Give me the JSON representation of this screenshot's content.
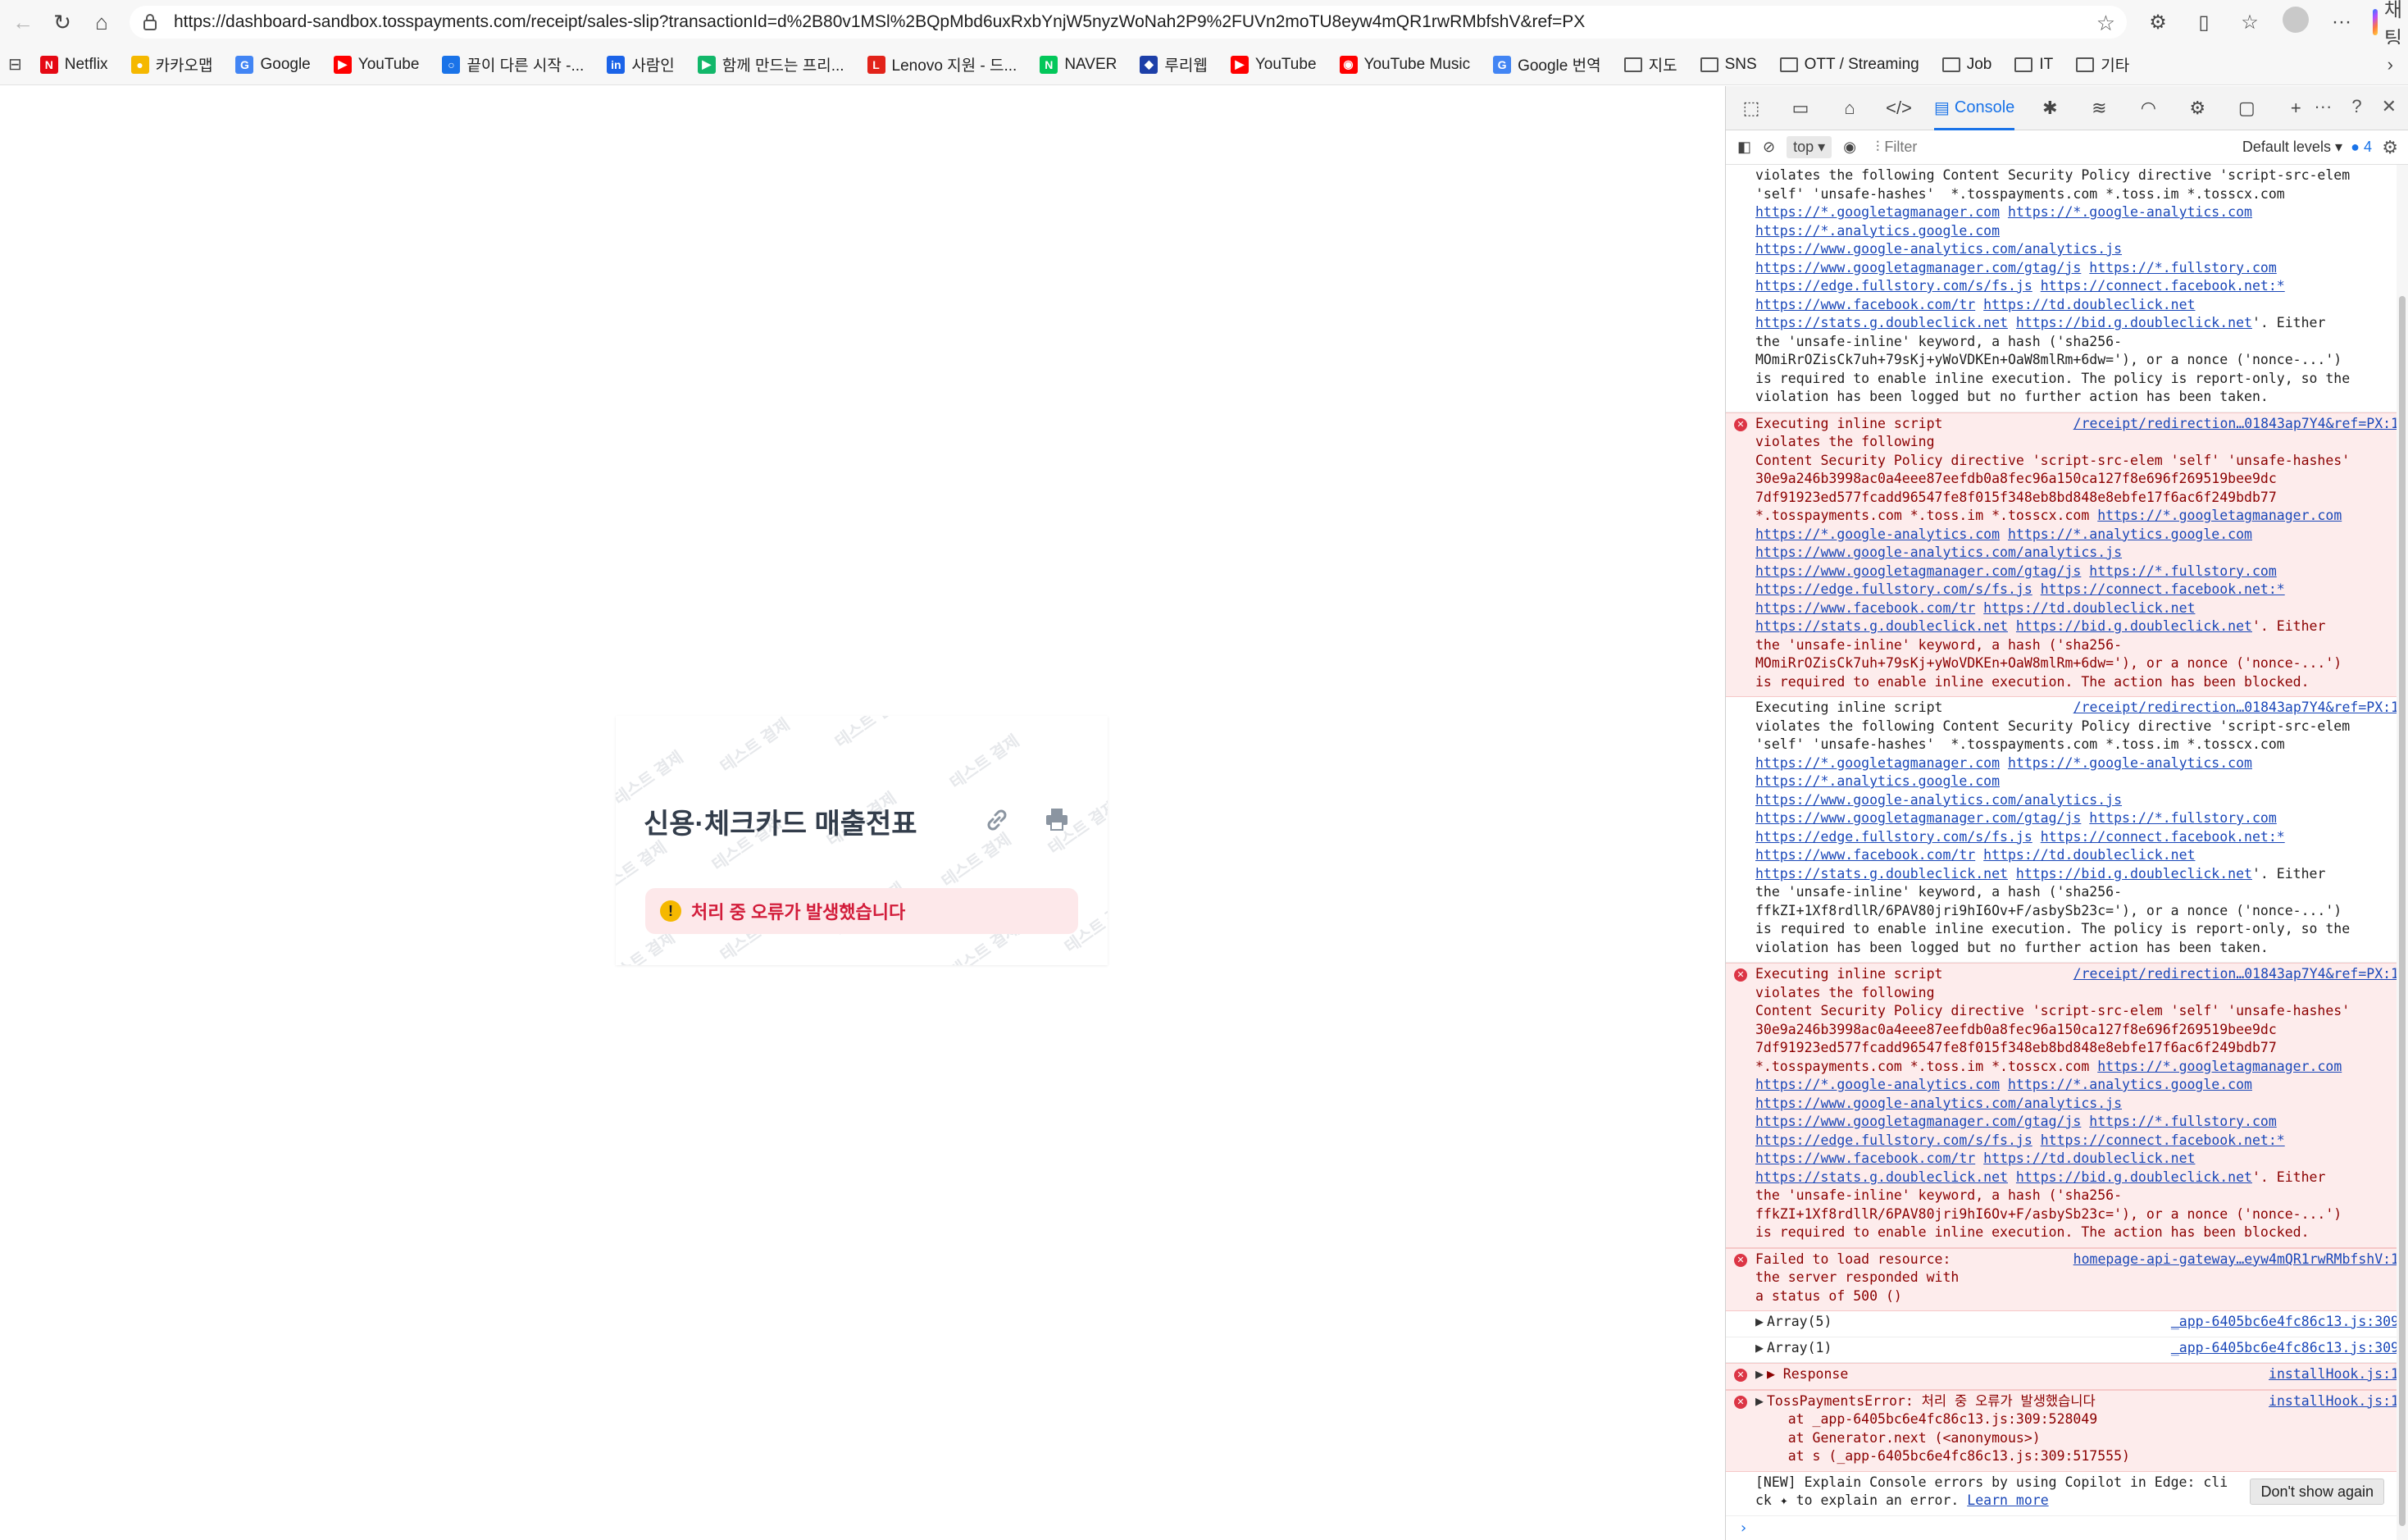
{
  "browser": {
    "url": "https://dashboard-sandbox.tosspayments.com/receipt/sales-slip?transactionId=d%2B80v1MSl%2BQpMbd6uxRxbYnjW5nyzWoNah2P9%2FUVn2moTU8eyw4mQR1rwRMbfshV&ref=PX",
    "copilot_label": "채팅"
  },
  "bookmarks": [
    {
      "label": "Netflix",
      "icon": "netflix-icon",
      "color": "#e50914",
      "glyph": "N"
    },
    {
      "label": "카카오맵",
      "icon": "kakaomap-icon",
      "color": "#f5b800",
      "glyph": "●"
    },
    {
      "label": "Google",
      "icon": "google-icon",
      "color": "#4285f4",
      "glyph": "G"
    },
    {
      "label": "YouTube",
      "icon": "youtube-icon",
      "color": "#ff0000",
      "glyph": "▶"
    },
    {
      "label": "끝이 다른 시작 -...",
      "icon": "chat-bubble-icon",
      "color": "#1a73e8",
      "glyph": "○"
    },
    {
      "label": "사람인",
      "icon": "saramin-icon",
      "color": "#1b63e8",
      "glyph": "in"
    },
    {
      "label": "함께 만드는 프리...",
      "icon": "green-logo-icon",
      "color": "#12b76a",
      "glyph": "▶"
    },
    {
      "label": "Lenovo 지원 - 드...",
      "icon": "lenovo-icon",
      "color": "#e2231a",
      "glyph": "L"
    },
    {
      "label": "NAVER",
      "icon": "naver-icon",
      "color": "#03c75a",
      "glyph": "N"
    },
    {
      "label": "루리웹",
      "icon": "ruliweb-icon",
      "color": "#1d3fa8",
      "glyph": "◆"
    },
    {
      "label": "YouTube",
      "icon": "youtube-icon",
      "color": "#ff0000",
      "glyph": "▶"
    },
    {
      "label": "YouTube Music",
      "icon": "youtube-music-icon",
      "color": "#ff0000",
      "glyph": "◉"
    },
    {
      "label": "Google 번역",
      "icon": "google-translate-icon",
      "color": "#4285f4",
      "glyph": "G"
    },
    {
      "label": "지도",
      "icon": "folder-icon",
      "folder": true
    },
    {
      "label": "SNS",
      "icon": "folder-icon",
      "folder": true
    },
    {
      "label": "OTT / Streaming",
      "icon": "folder-icon",
      "folder": true
    },
    {
      "label": "Job",
      "icon": "folder-icon",
      "folder": true
    },
    {
      "label": "IT",
      "icon": "folder-icon",
      "folder": true
    },
    {
      "label": "기타",
      "icon": "folder-icon",
      "folder": true
    }
  ],
  "receipt": {
    "title": "신용·체크카드 매출전표",
    "error": "처리 중 오류가 발생했습니다",
    "watermark": "테스트 결제"
  },
  "devtools": {
    "console_tab": "Console",
    "context": "top",
    "filter_placeholder": "Filter",
    "levels": "Default levels",
    "issues_count": "4",
    "dont_show": "Don't show again",
    "copilot_hint_prefix": "[NEW] Explain Console errors by using Copilot in Edge: click ",
    "copilot_hint_suffix": " to explain an error. ",
    "learn_more": "Learn more"
  },
  "console_messages": [
    {
      "level": "warning",
      "lines": [
        "violates the following Content Security Policy directive 'script-src-elem",
        "'self' 'unsafe-hashes'  *.tosspayments.com *.toss.im *.tosscx.com",
        "https://*.googletagmanager.com https://*.google-analytics.com",
        "https://*.analytics.google.com",
        "https://www.google-analytics.com/analytics.js",
        "https://www.googletagmanager.com/gtag/js https://*.fullstory.com",
        "https://edge.fullstory.com/s/fs.js https://connect.facebook.net:*",
        "https://www.facebook.com/tr https://td.doubleclick.net",
        "https://stats.g.doubleclick.net https://bid.g.doubleclick.net'. Either",
        "the 'unsafe-inline' keyword, a hash ('sha256-",
        "MOmiRrOZisCk7uh+79sKj+yWoVDKEn+OaW8mlRm+6dw='), or a nonce ('nonce-...')",
        "is required to enable inline execution. The policy is report-only, so the",
        "violation has been logged but no further action has been taken."
      ]
    },
    {
      "level": "error",
      "source": "/receipt/redirection…01843ap7Y4&ref=PX:1",
      "lines": [
        "Executing inline script",
        "violates the following",
        "Content Security Policy directive 'script-src-elem 'self' 'unsafe-hashes'",
        "30e9a246b3998ac0a4eee87eefdb0a8fec96a150ca127f8e696f269519bee9dc",
        "7df91923ed577fcadd96547fe8f015f348eb8bd848e8ebfe17f6ac6f249bdb77",
        "*.tosspayments.com *.toss.im *.tosscx.com https://*.googletagmanager.com",
        "https://*.google-analytics.com https://*.analytics.google.com",
        "https://www.google-analytics.com/analytics.js",
        "https://www.googletagmanager.com/gtag/js https://*.fullstory.com",
        "https://edge.fullstory.com/s/fs.js https://connect.facebook.net:*",
        "https://www.facebook.com/tr https://td.doubleclick.net",
        "https://stats.g.doubleclick.net https://bid.g.doubleclick.net'. Either",
        "the 'unsafe-inline' keyword, a hash ('sha256-",
        "MOmiRrOZisCk7uh+79sKj+yWoVDKEn+OaW8mlRm+6dw='), or a nonce ('nonce-...')",
        "is required to enable inline execution. The action has been blocked."
      ]
    },
    {
      "level": "warning",
      "source": "/receipt/redirection…01843ap7Y4&ref=PX:1",
      "lines": [
        "Executing inline script",
        "violates the following Content Security Policy directive 'script-src-elem",
        "'self' 'unsafe-hashes'  *.tosspayments.com *.toss.im *.tosscx.com",
        "https://*.googletagmanager.com https://*.google-analytics.com",
        "https://*.analytics.google.com",
        "https://www.google-analytics.com/analytics.js",
        "https://www.googletagmanager.com/gtag/js https://*.fullstory.com",
        "https://edge.fullstory.com/s/fs.js https://connect.facebook.net:*",
        "https://www.facebook.com/tr https://td.doubleclick.net",
        "https://stats.g.doubleclick.net https://bid.g.doubleclick.net'. Either",
        "the 'unsafe-inline' keyword, a hash ('sha256-",
        "ffkZI+1Xf8rdllR/6PAV80jri9hI6Ov+F/asbySb23c='), or a nonce ('nonce-...')",
        "is required to enable inline execution. The policy is report-only, so the",
        "violation has been logged but no further action has been taken."
      ]
    },
    {
      "level": "error",
      "source": "/receipt/redirection…01843ap7Y4&ref=PX:1",
      "lines": [
        "Executing inline script",
        "violates the following",
        "Content Security Policy directive 'script-src-elem 'self' 'unsafe-hashes'",
        "30e9a246b3998ac0a4eee87eefdb0a8fec96a150ca127f8e696f269519bee9dc",
        "7df91923ed577fcadd96547fe8f015f348eb8bd848e8ebfe17f6ac6f249bdb77",
        "*.tosspayments.com *.toss.im *.tosscx.com https://*.googletagmanager.com",
        "https://*.google-analytics.com https://*.analytics.google.com",
        "https://www.google-analytics.com/analytics.js",
        "https://www.googletagmanager.com/gtag/js https://*.fullstory.com",
        "https://edge.fullstory.com/s/fs.js https://connect.facebook.net:*",
        "https://www.facebook.com/tr https://td.doubleclick.net",
        "https://stats.g.doubleclick.net https://bid.g.doubleclick.net'. Either",
        "the 'unsafe-inline' keyword, a hash ('sha256-",
        "ffkZI+1Xf8rdllR/6PAV80jri9hI6Ov+F/asbySb23c='), or a nonce ('nonce-...')",
        "is required to enable inline execution. The action has been blocked."
      ]
    },
    {
      "level": "error",
      "source": "homepage-api-gateway…eyw4mQR1rwRMbfshV:1",
      "lines": [
        "Failed to load resource:",
        "the server responded with",
        "a status of 500 ()"
      ]
    },
    {
      "level": "log",
      "expandable": true,
      "source": "_app-6405bc6e4fc86c13.js:309",
      "lines": [
        "Array(5)"
      ]
    },
    {
      "level": "log",
      "expandable": true,
      "source": "_app-6405bc6e4fc86c13.js:309",
      "lines": [
        "Array(1)"
      ]
    },
    {
      "level": "error",
      "expandable": true,
      "source": "installHook.js:1",
      "lines": [
        "▶ Response"
      ]
    },
    {
      "level": "error",
      "expandable": true,
      "source": "installHook.js:1",
      "lines": [
        "TossPaymentsError: 처리 중 오류가 발생했습니다",
        "    at _app-6405bc6e4fc86c13.js:309:528049",
        "    at Generator.next (<anonymous>)",
        "    at s (_app-6405bc6e4fc86c13.js:309:517555)"
      ]
    }
  ]
}
